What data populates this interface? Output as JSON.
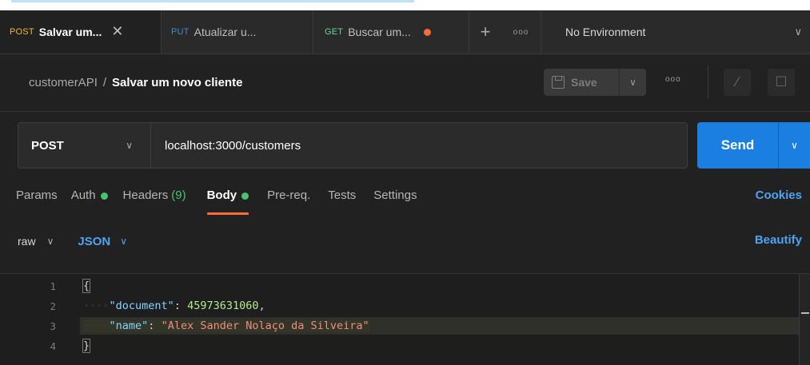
{
  "tabs": [
    {
      "method": "POST",
      "title": "Salvar um...",
      "active": true
    },
    {
      "method": "PUT",
      "title": "Atualizar u..."
    },
    {
      "method": "GET",
      "title": "Buscar um..."
    }
  ],
  "tabs_actions": {
    "new_tab_icon": "plus-icon",
    "more_icon": "ellipsis-icon"
  },
  "environment": {
    "label": "No Environment"
  },
  "breadcrumb": {
    "collection": "customerAPI",
    "separator": "/",
    "request": "Salvar um novo cliente"
  },
  "save": {
    "label": "Save"
  },
  "request": {
    "method": "POST",
    "url": "localhost:3000/customers"
  },
  "send": {
    "label": "Send"
  },
  "request_tabs": [
    {
      "label": "Params"
    },
    {
      "label": "Auth"
    },
    {
      "label": "Headers",
      "count": "(9)"
    },
    {
      "label": "Body",
      "active": true
    },
    {
      "label": "Pre-req."
    },
    {
      "label": "Tests"
    },
    {
      "label": "Settings"
    }
  ],
  "cookies": {
    "label": "Cookies"
  },
  "body_options": {
    "mode": "raw",
    "language": "JSON",
    "beautify": "Beautify"
  },
  "editor": {
    "line_numbers": [
      "1",
      "2",
      "3",
      "4"
    ],
    "lines": [
      {
        "open": "{"
      },
      {
        "key": "\"document\"",
        "colon": ": ",
        "value": "45973631060",
        "trail": ","
      },
      {
        "key": "\"name\"",
        "colon": ": ",
        "value": "\"Alex Sander Nolaço da Silveira\"",
        "trail": ""
      },
      {
        "close": "}"
      }
    ]
  },
  "colors": {
    "accent": "#ff6c37",
    "send": "#1a7fe0",
    "link": "#4ea3f2",
    "ok_dot": "#49c36f"
  }
}
